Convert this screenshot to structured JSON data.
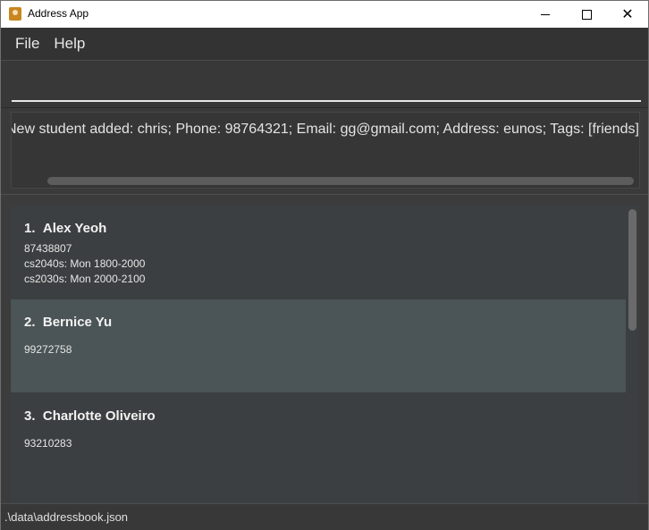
{
  "window": {
    "title": "Address App",
    "icon": "address-book-icon",
    "controls": [
      "minimize-icon",
      "maximize-icon",
      "close-icon"
    ]
  },
  "menu": {
    "file": "File",
    "help": "Help"
  },
  "command": {
    "value": "",
    "placeholder": ""
  },
  "result": {
    "text": "New student added: chris; Phone: 98764321; Email: gg@gmail.com; Address: eunos; Tags: [friends]"
  },
  "persons": [
    {
      "index": "1.",
      "name": "Alex Yeoh",
      "phone": "87438807",
      "details": [
        "cs2040s: Mon 1800-2000",
        "cs2030s: Mon 2000-2100"
      ],
      "selected": false
    },
    {
      "index": "2.",
      "name": "Bernice Yu",
      "phone": "99272758",
      "details": [],
      "selected": true
    },
    {
      "index": "3.",
      "name": "Charlotte Oliveiro",
      "phone": "93210283",
      "details": [],
      "selected": false
    }
  ],
  "status": {
    "path": ".\\data\\addressbook.json"
  },
  "colors": {
    "background": "#383838",
    "card": "#3c3f41",
    "card_selected": "#4b5456"
  }
}
